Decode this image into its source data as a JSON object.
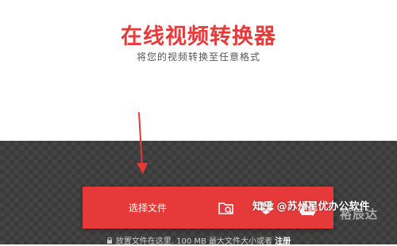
{
  "hero": {
    "title": "在线视频转换器",
    "subtitle": "将您的视频转换至任意格式"
  },
  "toolbar": {
    "choose_file_label": "选择文件",
    "icons": [
      "folder-search-icon",
      "dropbox-icon",
      "google-drive-icon"
    ]
  },
  "note": {
    "text": "放置文件在这里. 100 MB 最大文件大小或者",
    "register_label": "注册"
  },
  "watermarks": {
    "zhihu": "知乎 @苏州星优办公软件",
    "brand": "裕辰达"
  },
  "colors": {
    "accent": "#e63a3a",
    "title": "#e73b3b",
    "dark_bg": "#3b3b3b"
  }
}
